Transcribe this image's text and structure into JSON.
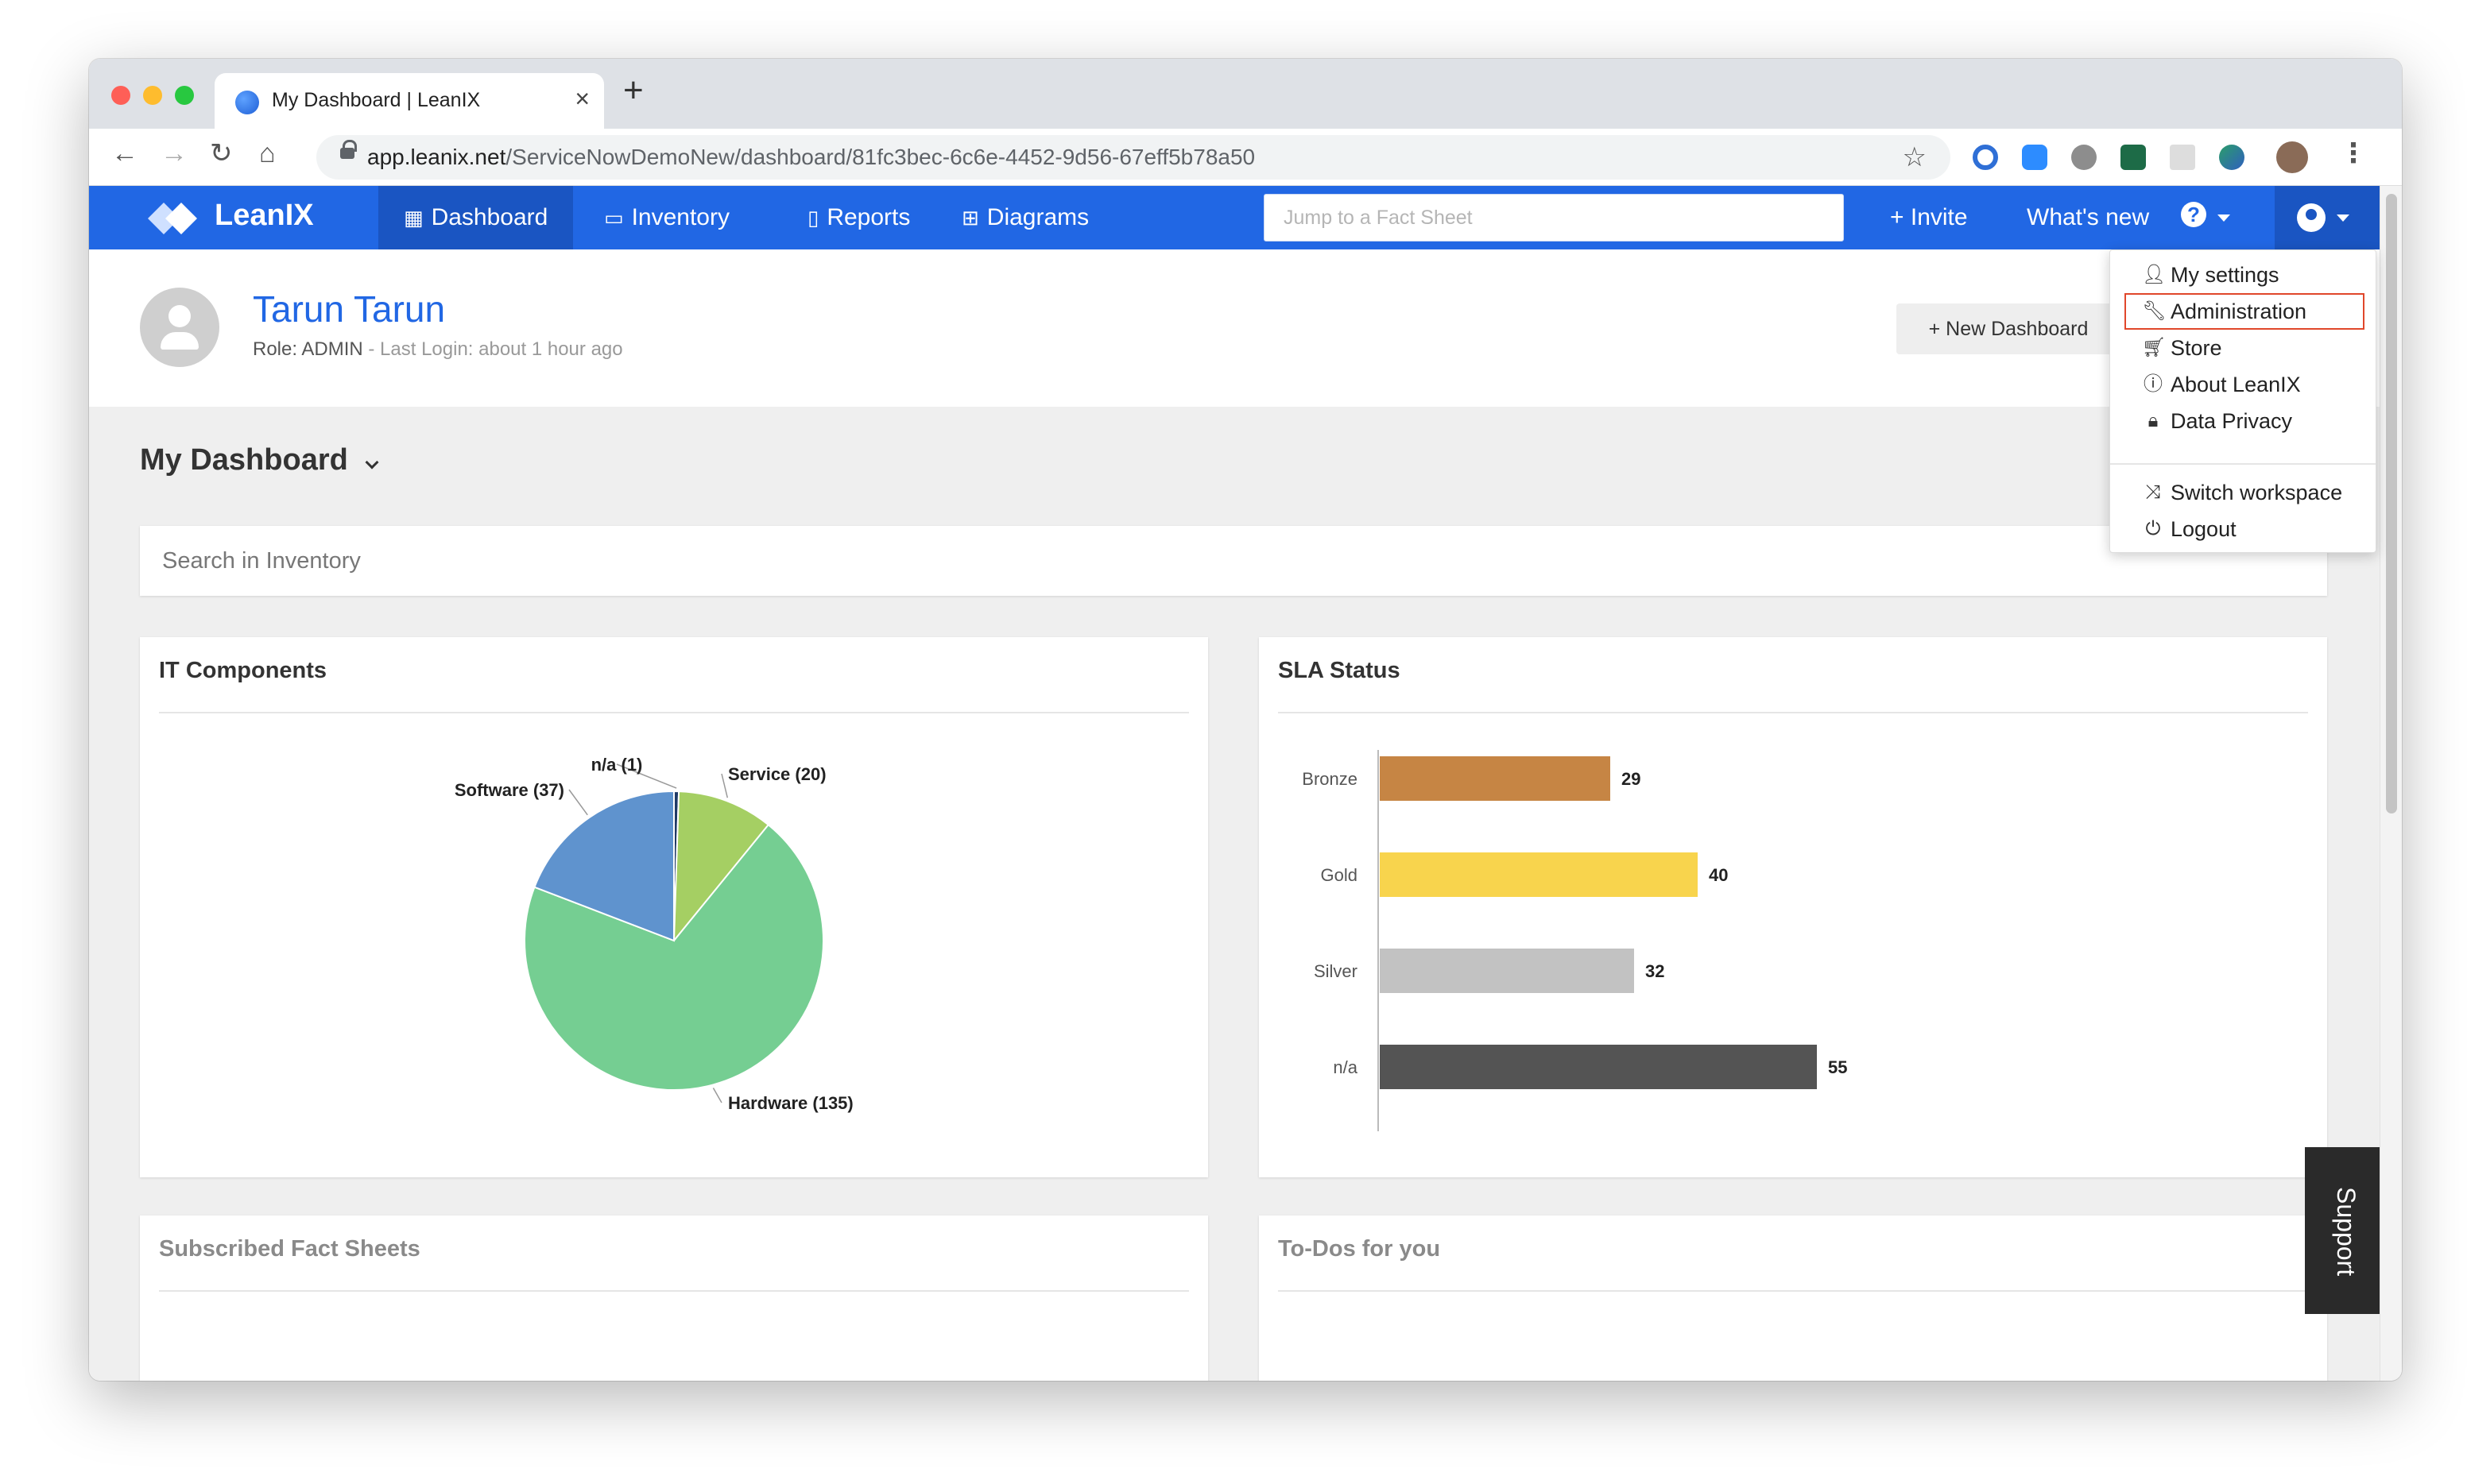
{
  "browser": {
    "tab_title": "My Dashboard | LeanIX",
    "url_host": "app.leanix.net",
    "url_path": "/ServiceNowDemoNew/dashboard/81fc3bec-6c6e-4452-9d56-67eff5b78a50"
  },
  "header": {
    "logo_text": "LeanIX",
    "nav": [
      {
        "label": "Dashboard",
        "icon": "grid-icon"
      },
      {
        "label": "Inventory",
        "icon": "inventory-icon"
      },
      {
        "label": "Reports",
        "icon": "bar-chart-icon"
      },
      {
        "label": "Diagrams",
        "icon": "sitemap-icon"
      }
    ],
    "search_placeholder": "Jump to a Fact Sheet",
    "invite_label": "+ Invite",
    "whats_new_label": "What's new"
  },
  "profile": {
    "name": "Tarun Tarun",
    "role": "Role: ADMIN",
    "last_login": " - Last Login: about 1 hour ago",
    "new_dashboard_label": "+ New Dashboard"
  },
  "dashboard": {
    "title": "My Dashboard",
    "search_placeholder": "Search in Inventory"
  },
  "cards": {
    "it_components": "IT Components",
    "sla_status": "SLA Status",
    "subscribed": "Subscribed Fact Sheets",
    "todos": "To-Dos for you"
  },
  "support_label": "Support",
  "user_menu": {
    "items": [
      {
        "label": "My settings",
        "icon": "user-icon"
      },
      {
        "label": "Administration",
        "icon": "wrench-icon"
      },
      {
        "label": "Store",
        "icon": "cart-icon"
      },
      {
        "label": "About LeanIX",
        "icon": "info-icon"
      },
      {
        "label": "Data Privacy",
        "icon": "lock-icon"
      },
      {
        "label": "Switch workspace",
        "icon": "shuffle-icon"
      },
      {
        "label": "Logout",
        "icon": "power-icon"
      }
    ]
  },
  "chart_data": [
    {
      "type": "pie",
      "title": "IT Components",
      "categories": [
        "n/a (1)",
        "Service (20)",
        "Hardware (135)",
        "Software (37)"
      ],
      "values": [
        1,
        20,
        135,
        37
      ],
      "colors": [
        "#1f3a66",
        "#a5cf63",
        "#75ce92",
        "#5f93ce"
      ]
    },
    {
      "type": "bar",
      "orientation": "horizontal",
      "title": "SLA Status",
      "categories": [
        "Bronze",
        "Gold",
        "Silver",
        "n/a"
      ],
      "values": [
        29,
        40,
        32,
        55
      ],
      "colors": [
        "#c68544",
        "#f8d44d",
        "#c2c2c2",
        "#545454"
      ]
    }
  ]
}
